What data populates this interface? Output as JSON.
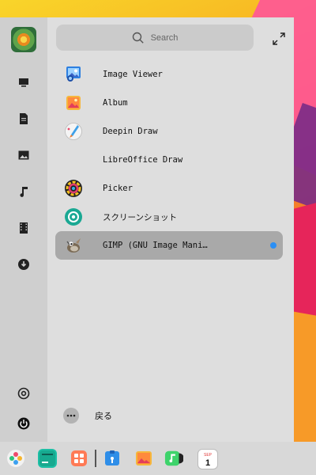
{
  "search": {
    "placeholder": "Search"
  },
  "apps": [
    {
      "name": "Image Viewer",
      "icon": "image-viewer-icon"
    },
    {
      "name": "Album",
      "icon": "album-icon"
    },
    {
      "name": "Deepin Draw",
      "icon": "deepin-draw-icon"
    },
    {
      "name": "LibreOffice Draw",
      "icon": ""
    },
    {
      "name": "Picker",
      "icon": "picker-icon"
    },
    {
      "name": "スクリーンショット",
      "icon": "screenshot-icon"
    },
    {
      "name": "GIMP (GNU Image Mani…",
      "icon": "gimp-icon",
      "selected": true
    }
  ],
  "back": {
    "label": "戻る"
  },
  "sidebar_categories": [
    "computer-icon",
    "document-icon",
    "picture-icon",
    "music-icon",
    "video-icon",
    "download-icon"
  ],
  "dock_icons": [
    "launcher-icon",
    "terminal-icon",
    "app-store-icon",
    "file-manager-icon",
    "album-icon",
    "music-icon",
    "calendar-icon"
  ],
  "calendar": {
    "month": "SEP",
    "day": "1"
  },
  "colors": {
    "selected_row": "#a9a9a9",
    "new_dot": "#2b8ff5",
    "panel": "#dedede",
    "sidebar": "#cfcfcf"
  }
}
